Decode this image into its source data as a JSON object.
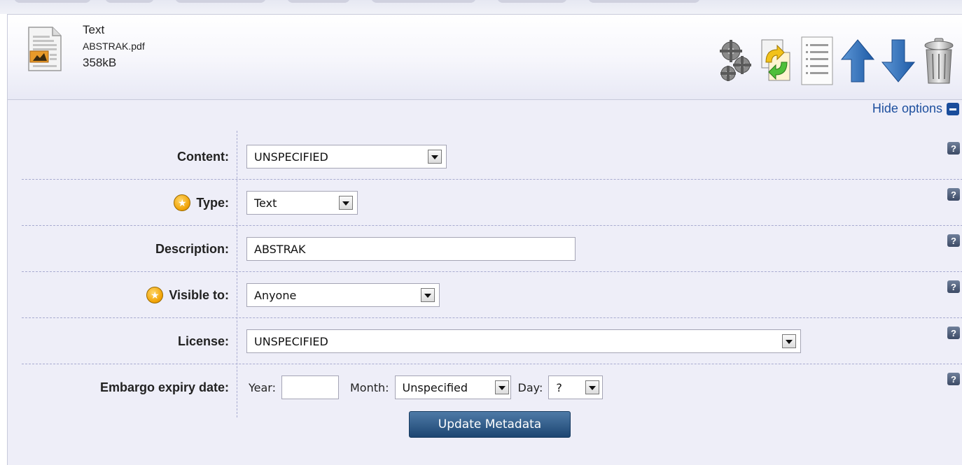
{
  "file": {
    "type": "Text",
    "name": "ABSTRAK.pdf",
    "size": "358kB"
  },
  "toolbar": {
    "icons": [
      "gears-icon",
      "replace-file-icon",
      "document-details-icon",
      "move-up-icon",
      "move-down-icon",
      "trash-icon"
    ]
  },
  "options_toggle": "Hide options",
  "form": {
    "content": {
      "label": "Content:",
      "value": "UNSPECIFIED",
      "required": false
    },
    "type": {
      "label": "Type:",
      "value": "Text",
      "required": true
    },
    "description": {
      "label": "Description:",
      "value": "ABSTRAK",
      "required": false
    },
    "visible_to": {
      "label": "Visible to:",
      "value": "Anyone",
      "required": true
    },
    "license": {
      "label": "License:",
      "value": "UNSPECIFIED",
      "required": false
    },
    "embargo": {
      "label": "Embargo expiry date:",
      "year_label": "Year:",
      "year_value": "",
      "month_label": "Month:",
      "month_value": "Unspecified",
      "day_label": "Day:",
      "day_value": "?"
    },
    "help_glyph": "?"
  },
  "submit_label": "Update Metadata",
  "colors": {
    "accent": "#1d4f9e",
    "panel_bg": "#eeeef8",
    "button_bg": "#2e5a88",
    "required_star": "#f0a000"
  }
}
